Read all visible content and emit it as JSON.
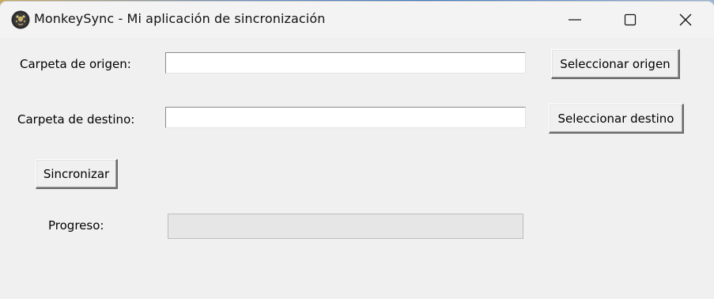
{
  "window": {
    "title": "MonkeySync - Mi aplicación de sincronización",
    "controls": [
      "minimize",
      "maximize",
      "close"
    ]
  },
  "form": {
    "source_label": "Carpeta de origen:",
    "source_value": "",
    "source_button": "Seleccionar origen",
    "dest_label": "Carpeta de destino:",
    "dest_value": "",
    "dest_button": "Seleccionar destino",
    "sync_button": "Sincronizar",
    "progress_label": "Progreso:",
    "progress_value": 0
  },
  "colors": {
    "window_bg": "#f0f0f0",
    "titlebar_bg": "#f3f3f3",
    "progress_track": "#e6e6e6",
    "progress_fill": "#06b025"
  }
}
